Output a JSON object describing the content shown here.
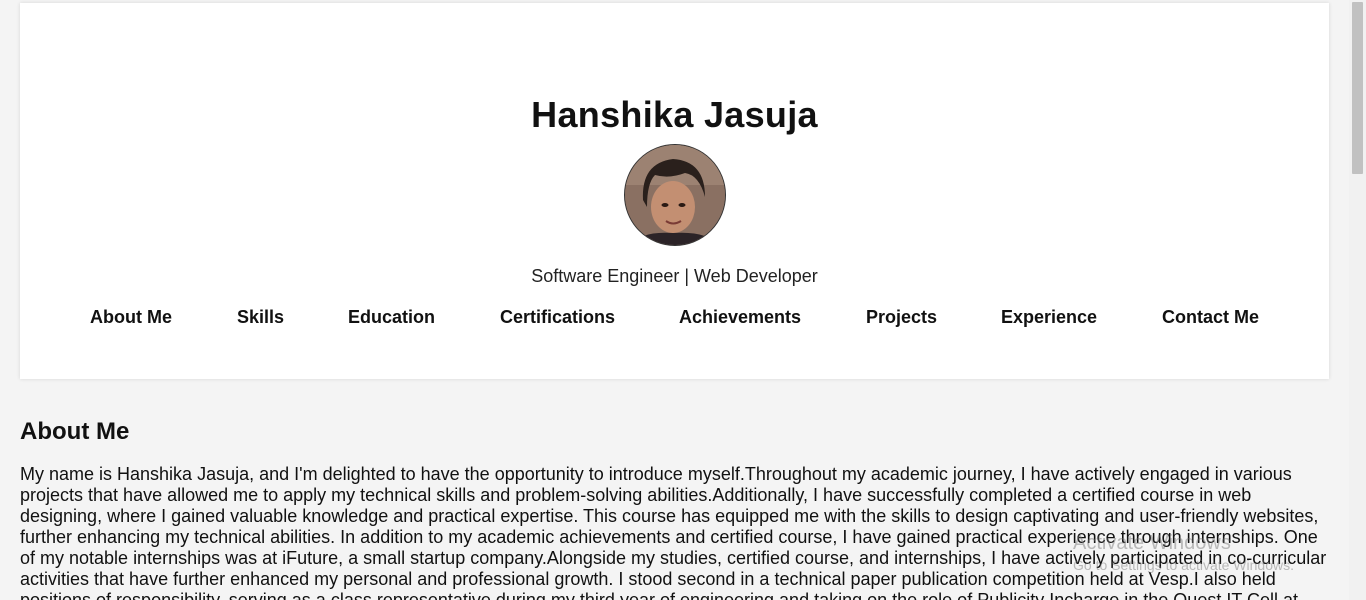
{
  "header": {
    "name": "Hanshika Jasuja",
    "tagline": "Software Engineer | Web Developer"
  },
  "nav": {
    "items": [
      {
        "label": "About Me"
      },
      {
        "label": "Skills"
      },
      {
        "label": "Education"
      },
      {
        "label": "Certifications"
      },
      {
        "label": "Achievements"
      },
      {
        "label": "Projects"
      },
      {
        "label": "Experience"
      },
      {
        "label": "Contact Me"
      }
    ]
  },
  "about": {
    "title": "About Me",
    "text": "My name is Hanshika Jasuja, and I'm delighted to have the opportunity to introduce myself.Throughout my academic journey, I have actively engaged in various projects that have allowed me to apply my technical skills and problem-solving abilities.Additionally, I have successfully completed a certified course in web designing, where I gained valuable knowledge and practical expertise. This course has equipped me with the skills to design captivating and user-friendly websites, further enhancing my technical abilities. In addition to my academic achievements and certified course, I have gained practical experience through internships. One of my notable internships was at iFuture, a small startup company.Alongside my studies, certified course, and internships, I have actively participated in co-curricular activities that have further enhanced my personal and professional growth. I stood second in a technical paper publication competition held at Vesp.I also held positions of responsibility, serving as a class representative during my third year of engineering and taking on the role of Publicity Incharge in the Quest IT Cell at"
  },
  "watermark": {
    "title": "Activate Windows",
    "subtitle": "Go to Settings to activate Windows."
  },
  "colors": {
    "page_background": "#f4f4f4",
    "card_background": "#ffffff",
    "text": "#111111"
  }
}
